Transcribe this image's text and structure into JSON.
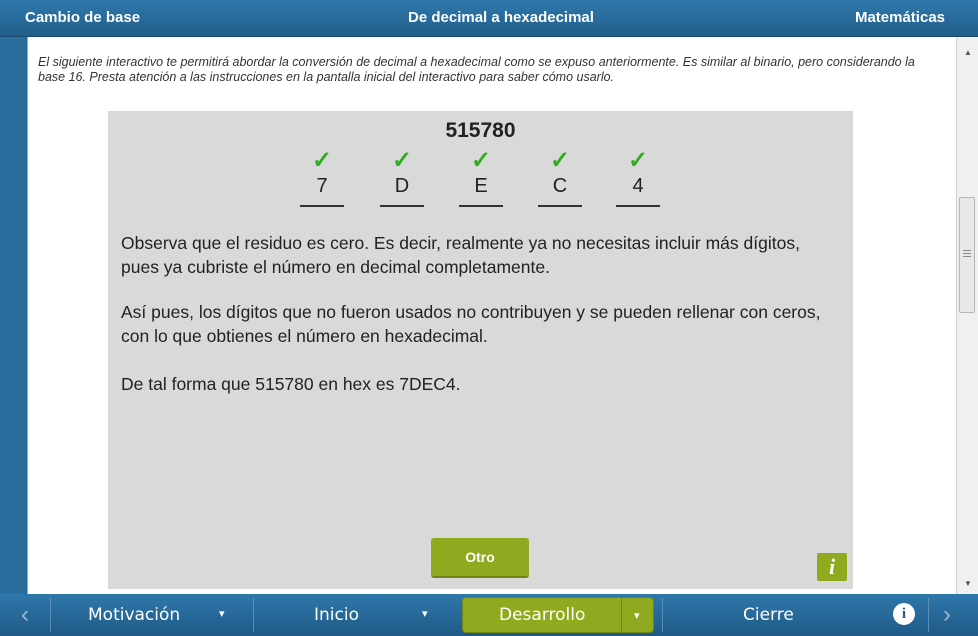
{
  "header": {
    "left": "Cambio de base",
    "center": "De decimal a hexadecimal",
    "right": "Matemáticas"
  },
  "intro": "El siguiente interactivo te permitirá abordar la conversión de decimal a hexadecimal como se expuso anteriormente. Es similar al binario, pero considerando la base 16. Presta atención a las instrucciones en la pantalla inicial del interactivo para saber cómo usarlo.",
  "interactive": {
    "number": "515780",
    "digits": [
      {
        "check": "✓",
        "value": "7"
      },
      {
        "check": "✓",
        "value": "D"
      },
      {
        "check": "✓",
        "value": "E"
      },
      {
        "check": "✓",
        "value": "C"
      },
      {
        "check": "✓",
        "value": "4"
      }
    ],
    "paragraphs": [
      "Observa que el residuo es cero. Es decir, realmente ya no necesitas incluir más dígitos, pues ya cubriste el número en decimal completamente.",
      "Así pues, los dígitos que no fueron usados no contribuyen y se pueden rellenar con ceros, con lo que obtienes el número en hexadecimal.",
      "De tal forma que 515780 en hex es 7DEC4."
    ],
    "button_label": "Otro",
    "info_label": "i",
    "accent_color": "#8faa1e",
    "check_color": "#2fae1f"
  },
  "nav": {
    "items": [
      {
        "label": "Motivación",
        "dropdown": "▾"
      },
      {
        "label": "Inicio",
        "dropdown": "▾"
      },
      {
        "label": "Desarrollo",
        "dropdown": "▾",
        "active": true
      },
      {
        "label": "Cierre"
      }
    ],
    "prev_icon": "‹",
    "next_icon": "›",
    "info_icon": "i"
  },
  "scrollbar": {
    "up_icon": "▲",
    "down_icon": "▼"
  }
}
